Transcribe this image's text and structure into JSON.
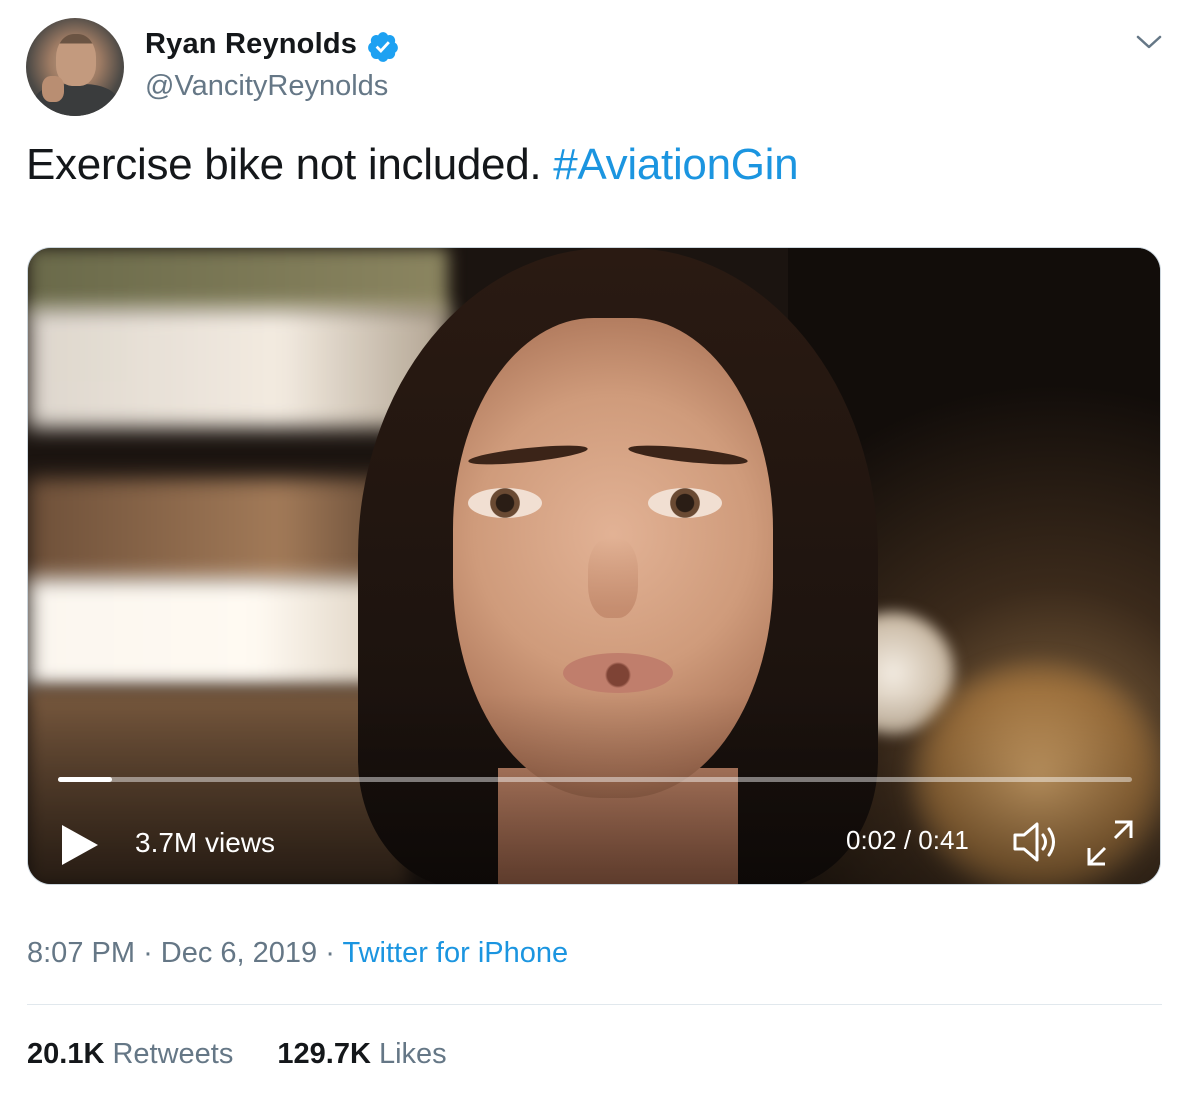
{
  "author": {
    "name": "Ryan Reynolds",
    "handle": "@VancityReynolds",
    "verified": true
  },
  "tweet": {
    "text": "Exercise bike not included.",
    "hashtag": "#AviationGin"
  },
  "video": {
    "views": "3.7M views",
    "time": "0:02 / 0:41",
    "progress_fraction": 0.05
  },
  "meta": {
    "time": "8:07 PM",
    "separator": "·",
    "date": "Dec 6, 2019",
    "source": "Twitter for iPhone"
  },
  "stats": {
    "retweets_count": "20.1K",
    "retweets_label": "Retweets",
    "likes_count": "129.7K",
    "likes_label": "Likes"
  },
  "colors": {
    "link": "#1b95e0",
    "secondary_text": "#657786",
    "primary_text": "#14171a",
    "verified_badge": "#1da1f2"
  },
  "icons": [
    "verified-badge-icon",
    "chevron-down-icon",
    "play-icon",
    "volume-icon",
    "fullscreen-icon"
  ]
}
